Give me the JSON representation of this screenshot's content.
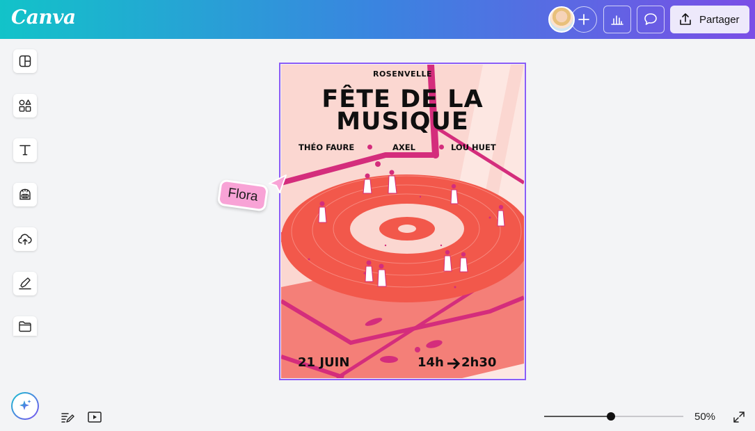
{
  "app": {
    "logo": "Canva"
  },
  "header": {
    "share_label": "Partager",
    "avatar_icon": "user-avatar",
    "add_icon": "plus-icon",
    "insights_icon": "bar-chart-icon",
    "comment_icon": "comment-icon",
    "share_icon": "upload-share-icon"
  },
  "sidebar": {
    "items": [
      {
        "icon": "design-templates-icon"
      },
      {
        "icon": "elements-icon"
      },
      {
        "icon": "text-icon"
      },
      {
        "icon": "brand-icon"
      },
      {
        "icon": "uploads-icon"
      },
      {
        "icon": "draw-icon"
      },
      {
        "icon": "projects-folder-icon"
      }
    ]
  },
  "poster": {
    "town": "ROSENVELLE",
    "title_line1": "FÊTE DE LA",
    "title_line2": "MUSIQUE",
    "artist1": "THÉO FAURE",
    "artist2": "AXEL",
    "artist3": "LOU HUET",
    "date": "21 JUIN",
    "time_start": "14h",
    "time_end": "2h30",
    "colors": {
      "background": "#fbd7d1",
      "record": "#f2584b",
      "accent": "#d42d7c"
    }
  },
  "collaborator": {
    "name": "Flora",
    "color": "#f8a3d6"
  },
  "footer": {
    "notes_icon": "notes-icon",
    "present_icon": "present-play-icon",
    "magic_icon": "sparkle-magic-icon",
    "zoom_label": "50%",
    "zoom_value": 0.5,
    "fullscreen_icon": "expand-icon"
  }
}
